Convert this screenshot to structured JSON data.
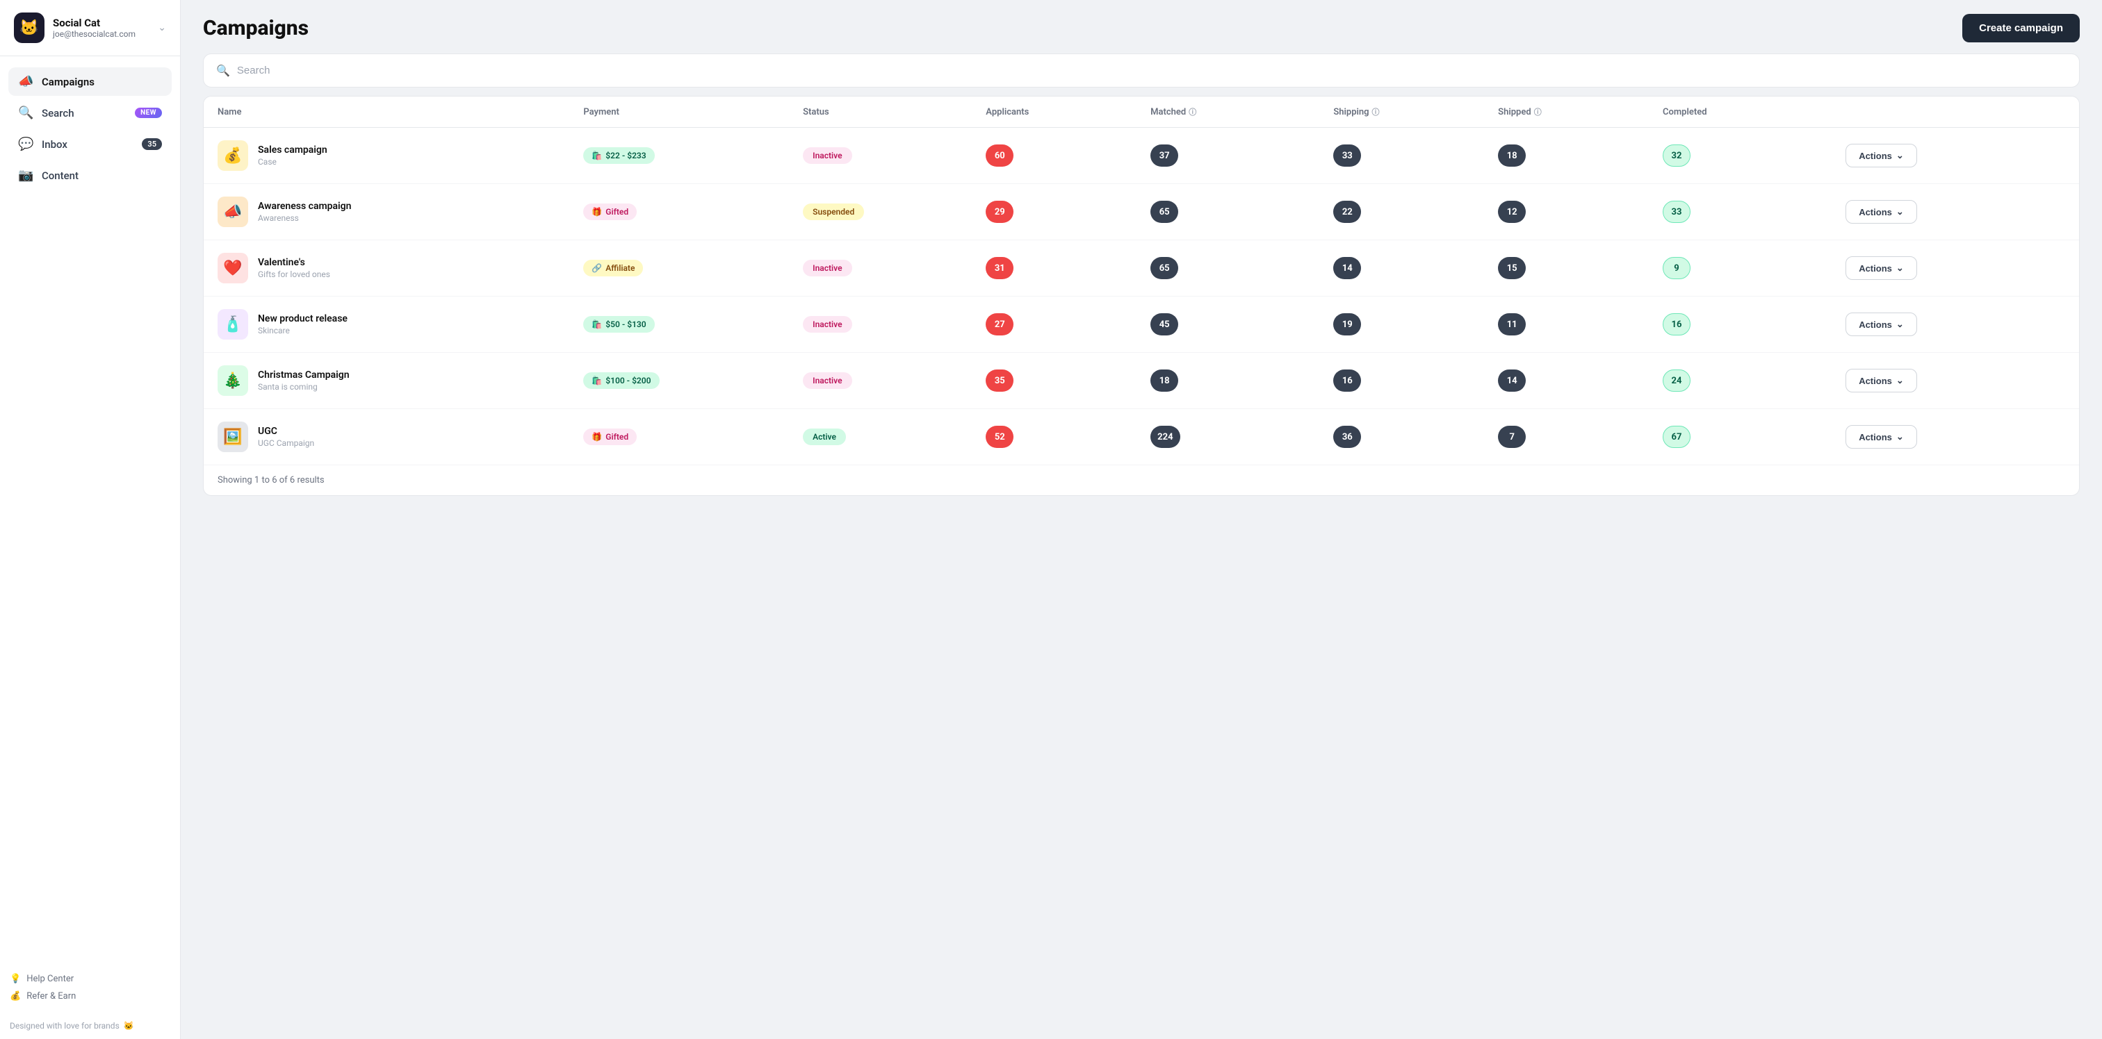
{
  "app": {
    "name": "Social Cat",
    "email": "joe@thesocialcat.com",
    "logo": "🐱"
  },
  "sidebar": {
    "items": [
      {
        "id": "campaigns",
        "icon": "📣",
        "label": "Campaigns",
        "active": true,
        "badge": null
      },
      {
        "id": "search",
        "icon": "🔍",
        "label": "Search",
        "active": false,
        "badge": "NEW"
      },
      {
        "id": "inbox",
        "icon": "💬",
        "label": "Inbox",
        "active": false,
        "badge": "35"
      },
      {
        "id": "content",
        "icon": "📷",
        "label": "Content",
        "active": false,
        "badge": null
      }
    ],
    "footer": [
      {
        "id": "help",
        "icon": "💡",
        "label": "Help Center"
      },
      {
        "id": "refer",
        "icon": "💰",
        "label": "Refer & Earn"
      }
    ],
    "designed": "Designed with love for brands"
  },
  "header": {
    "title": "Campaigns",
    "create_btn": "Create campaign"
  },
  "search": {
    "placeholder": "Search"
  },
  "table": {
    "columns": [
      "Name",
      "Payment",
      "Status",
      "Applicants",
      "Matched",
      "Shipping",
      "Shipped",
      "Completed",
      ""
    ],
    "rows": [
      {
        "icon": "💰",
        "icon_bg": "#fef3c7",
        "title": "Sales campaign",
        "subtitle": "Case",
        "payment_type": "paid",
        "payment_label": "$22 - $233",
        "payment_icon": "🛍️",
        "status": "inactive",
        "status_label": "Inactive",
        "applicants": 60,
        "matched": 37,
        "shipping": 33,
        "shipped": 18,
        "completed": 32
      },
      {
        "icon": "📣",
        "icon_bg": "#fde8c8",
        "title": "Awareness campaign",
        "subtitle": "Awareness",
        "payment_type": "gifted",
        "payment_label": "Gifted",
        "payment_icon": "🎁",
        "status": "suspended",
        "status_label": "Suspended",
        "applicants": 29,
        "matched": 65,
        "shipping": 22,
        "shipped": 12,
        "completed": 33
      },
      {
        "icon": "❤️",
        "icon_bg": "#fee2e2",
        "title": "Valentine's",
        "subtitle": "Gifts for loved ones",
        "payment_type": "affiliate",
        "payment_label": "Affiliate",
        "payment_icon": "🔗",
        "status": "inactive",
        "status_label": "Inactive",
        "applicants": 31,
        "matched": 65,
        "shipping": 14,
        "shipped": 15,
        "completed": 9
      },
      {
        "icon": "🧴",
        "icon_bg": "#f3e8ff",
        "title": "New product release",
        "subtitle": "Skincare",
        "payment_type": "paid",
        "payment_label": "$50 - $130",
        "payment_icon": "🛍️",
        "status": "inactive",
        "status_label": "Inactive",
        "applicants": 27,
        "matched": 45,
        "shipping": 19,
        "shipped": 11,
        "completed": 16
      },
      {
        "icon": "🎄",
        "icon_bg": "#dcfce7",
        "title": "Christmas Campaign",
        "subtitle": "Santa is coming",
        "payment_type": "paid",
        "payment_label": "$100 - $200",
        "payment_icon": "🛍️",
        "status": "inactive",
        "status_label": "Inactive",
        "applicants": 35,
        "matched": 18,
        "shipping": 16,
        "shipped": 14,
        "completed": 24
      },
      {
        "icon": "🖼️",
        "icon_bg": "#e5e7eb",
        "title": "UGC",
        "subtitle": "UGC Campaign",
        "payment_type": "gifted",
        "payment_label": "Gifted",
        "payment_icon": "🎁",
        "status": "active",
        "status_label": "Active",
        "applicants": 52,
        "matched": 224,
        "shipping": 36,
        "shipped": 7,
        "completed": 67
      }
    ],
    "footer": "Showing 1 to 6 of 6 results",
    "actions_label": "Actions"
  }
}
